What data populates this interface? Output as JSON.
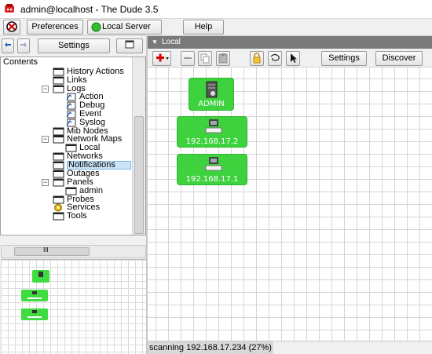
{
  "window": {
    "title": "admin@localhost - The Dude 3.5"
  },
  "toolbar": {
    "preferences_label": "Preferences",
    "server_label": "Local Server",
    "help_label": "Help",
    "server_status_color": "#2fbf2f"
  },
  "left_toolbar": {
    "settings_label": "Settings"
  },
  "contents": {
    "header": "Contents",
    "items": [
      {
        "label": "History Actions",
        "icon": "window-icon"
      },
      {
        "label": "Links",
        "icon": "window-icon"
      },
      {
        "label": "Logs",
        "icon": "window-icon",
        "expander": "−"
      },
      {
        "label": "Action",
        "icon": "log-icon"
      },
      {
        "label": "Debug",
        "icon": "log-icon"
      },
      {
        "label": "Event",
        "icon": "log-icon"
      },
      {
        "label": "Syslog",
        "icon": "log-icon"
      },
      {
        "label": "Mib Nodes",
        "icon": "window-icon"
      },
      {
        "label": "Network Maps",
        "icon": "window-icon",
        "expander": "−"
      },
      {
        "label": "Local",
        "icon": "window-icon"
      },
      {
        "label": "Networks",
        "icon": "window-icon"
      },
      {
        "label": "Notifications",
        "icon": "window-icon",
        "selected": true
      },
      {
        "label": "Outages",
        "icon": "window-icon"
      },
      {
        "label": "Panels",
        "icon": "window-icon",
        "expander": "−"
      },
      {
        "label": "admin",
        "icon": "window-icon"
      },
      {
        "label": "Probes",
        "icon": "window-icon"
      },
      {
        "label": "Services",
        "icon": "services-icon"
      },
      {
        "label": "Tools",
        "icon": "window-icon"
      }
    ]
  },
  "hscroll": {
    "thumb_label": "III"
  },
  "map": {
    "tab_label": "Local",
    "settings_label": "Settings",
    "discover_label": "Discover",
    "nodes": [
      {
        "label": "ADMIN",
        "icon": "server-icon"
      },
      {
        "label": "192.168.17.2",
        "icon": "computer-icon"
      },
      {
        "label": "192.168.17.1",
        "icon": "computer-icon"
      }
    ]
  },
  "status": {
    "text": "scanning 192.168.17.234 (27%)"
  },
  "colors": {
    "node_green": "#3ed23e",
    "selection_blue": "#cce4f7"
  }
}
